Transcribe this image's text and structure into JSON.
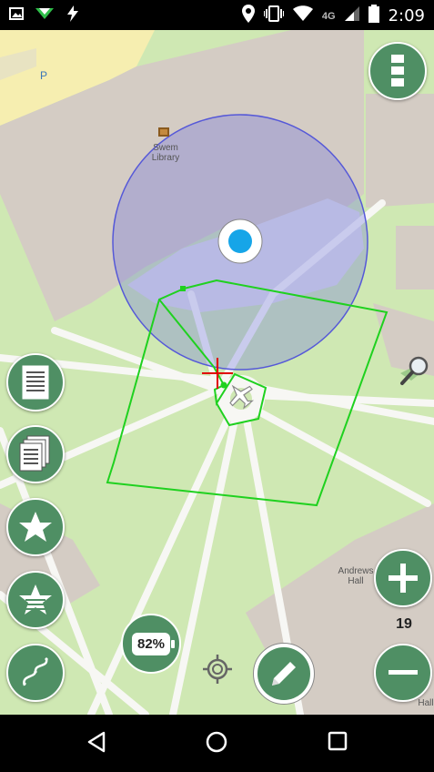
{
  "status_bar": {
    "time": "2:09",
    "network": "4G",
    "left_icons": [
      "image-icon",
      "signal-arrow-icon",
      "flash-icon"
    ],
    "right_icons": [
      "location-pin-icon",
      "vibrate-icon",
      "wifi-icon",
      "cell-signal-icon",
      "battery-icon"
    ]
  },
  "map": {
    "labels": {
      "swem": "Swem\nLibrary",
      "parking": "P",
      "andrews": "Andrews\nHall",
      "hall_partial": "Hall"
    },
    "zoom_level": "19",
    "colors": {
      "accuracy_circle": "#6a6fe0",
      "track": "#00d000",
      "target": "#e00000",
      "button": "#4f8f64"
    }
  },
  "controls": {
    "menu_button": "menu-icon",
    "zoom_in": "plus-icon",
    "zoom_out": "minus-icon",
    "battery_label": "82%",
    "search_icon": "map-search-icon"
  },
  "left_toolbar": [
    {
      "name": "single-page-icon"
    },
    {
      "name": "multi-page-icon"
    },
    {
      "name": "star-icon"
    },
    {
      "name": "star-list-icon"
    },
    {
      "name": "route-icon"
    }
  ],
  "navbar": [
    "back-icon",
    "home-icon",
    "recents-icon"
  ]
}
